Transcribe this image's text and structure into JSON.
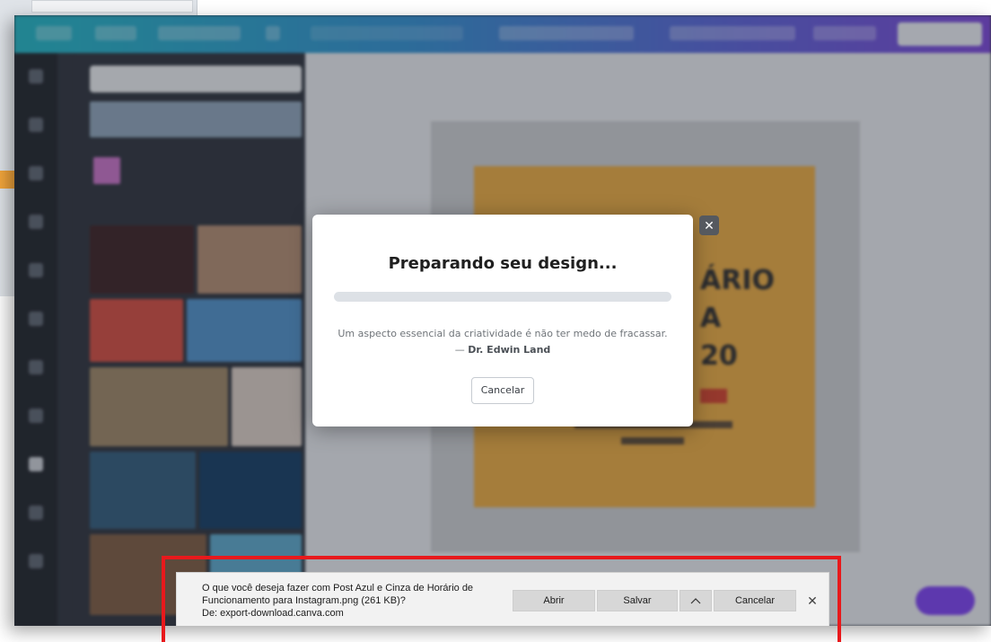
{
  "modal": {
    "title": "Preparando seu design...",
    "progress": 0.0,
    "quote_text": "Um aspecto essencial da criatividade é não ter medo de fracassar. — ",
    "quote_author": "Dr. Edwin Land",
    "cancel_label": "Cancelar",
    "close_icon": "close-icon"
  },
  "download_bar": {
    "message_line1": "O que você deseja fazer com Post Azul e Cinza de Horário de",
    "message_line2": "Funcionamento para Instagram.png (261 KB)?",
    "message_line3": "De: export-download.canva.com",
    "open_label": "Abrir",
    "save_label": "Salvar",
    "save_options_icon": "chevron-up-icon",
    "cancel_label": "Cancelar",
    "close_icon": "close-icon"
  },
  "design_preview": {
    "text_1": "ÁRIO",
    "text_2": "A",
    "text_3": "20"
  },
  "colors": {
    "highlight": "#e8191c",
    "modal_bg": "#ffffff",
    "design_gold": "#e8a940",
    "topbar_start": "#1fb5c4",
    "topbar_end": "#7a45d8"
  }
}
